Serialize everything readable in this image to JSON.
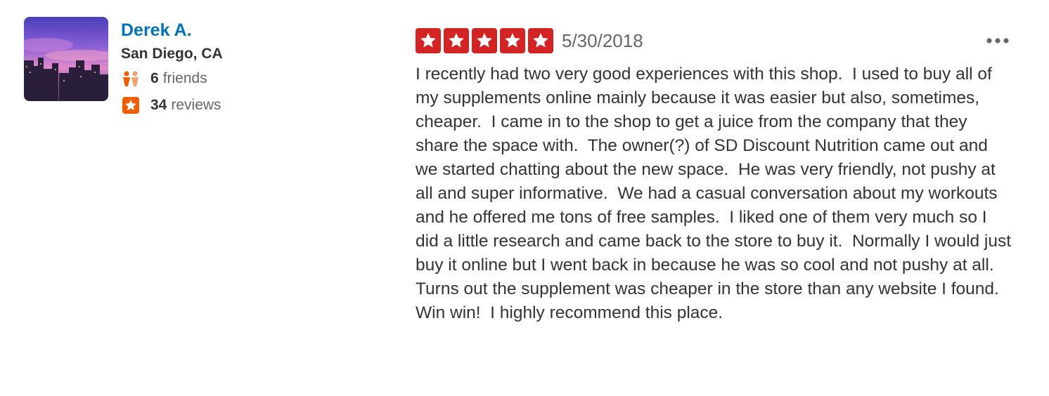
{
  "user": {
    "name": "Derek A.",
    "location": "San Diego, CA",
    "friends_count": "6",
    "friends_label": "friends",
    "reviews_count": "34",
    "reviews_label": "reviews",
    "avatar_icon": "profile-photo-city-skyline"
  },
  "review": {
    "rating": 5,
    "rating_max": 5,
    "date": "5/30/2018",
    "more_icon": "ellipsis-icon",
    "text": "I recently had two very good experiences with this shop.  I used to buy all of my supplements online mainly because it was easier but also, sometimes, cheaper.  I came in to the shop to get a juice from the company that they share the space with.  The owner(?) of SD Discount Nutrition came out and we started chatting about the new space.  He was very friendly, not pushy at all and super informative.  We had a casual conversation about my workouts and he offered me tons of free samples.  I liked one of them very much so I did a little research and came back to the store to buy it.  Normally I would just buy it online but I went back in because he was so cool and not pushy at all.  Turns out the supplement was cheaper in the store than any website I found.  Win win!  I highly recommend this place."
  },
  "colors": {
    "name_link": "#0073bb",
    "star": "#d32323",
    "friends_icon": "#f15c00",
    "reviews_icon": "#f15c00"
  }
}
